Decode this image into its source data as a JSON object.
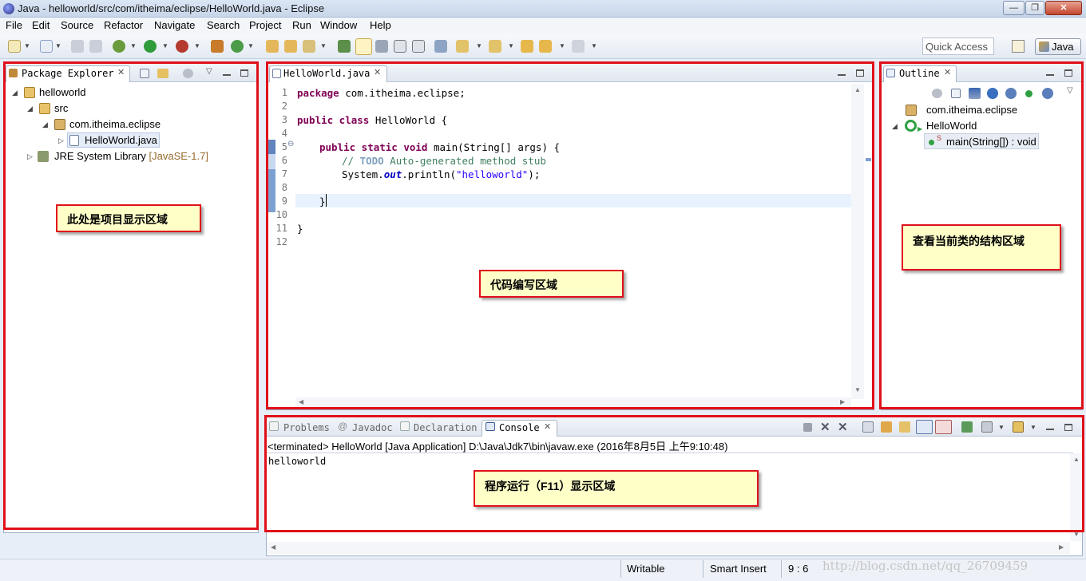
{
  "window": {
    "title": "Java - helloworld/src/com/itheima/eclipse/HelloWorld.java - Eclipse",
    "minimize": "—",
    "maximize": "❐",
    "close": "✕"
  },
  "menu": [
    "File",
    "Edit",
    "Source",
    "Refactor",
    "Navigate",
    "Search",
    "Project",
    "Run",
    "Window",
    "Help"
  ],
  "toolbar": {
    "quick_access_placeholder": "Quick Access",
    "perspective": "Java"
  },
  "package_explorer": {
    "tab_label": "Package Explorer",
    "tree": {
      "project": "helloworld",
      "src": "src",
      "package": "com.itheima.eclipse",
      "file": "HelloWorld.java",
      "library": "JRE System Library",
      "library_version": "[JavaSE-1.7]"
    }
  },
  "editor": {
    "tab_label": "HelloWorld.java",
    "line_numbers": [
      "1",
      "2",
      "3",
      "4",
      "5",
      "6",
      "7",
      "8",
      "9",
      "10",
      "11",
      "12"
    ],
    "code": {
      "l1_kw": "package",
      "l1_rest": " com.itheima.eclipse;",
      "l3_kw": "public class",
      "l3_rest": " HelloWorld {",
      "l5_kw": "public static void",
      "l5_rest": " main(String[] args) {",
      "l6_cm1": "// ",
      "l6_todo": "TODO",
      "l6_cm2": " Auto-generated method stub",
      "l7_a": "System.",
      "l7_field": "out",
      "l7_b": ".println(",
      "l7_str": "\"helloworld\"",
      "l7_c": ");",
      "l9": "}",
      "l11": "}"
    }
  },
  "outline": {
    "tab_label": "Outline",
    "package": "com.itheima.eclipse",
    "class": "HelloWorld",
    "method": "main(String[]) : void",
    "method_modifier": "S"
  },
  "console": {
    "tabs": [
      "Problems",
      "Javadoc",
      "Declaration",
      "Console"
    ],
    "tab_prefix_javadoc": "@",
    "status_line": "<terminated> HelloWorld [Java Application] D:\\Java\\Jdk7\\bin\\javaw.exe (2016年8月5日 上午9:10:48)",
    "output": "helloworld"
  },
  "annotations": {
    "project_area": "此处是项目显示区域",
    "code_area": "代码编写区域",
    "outline_area": "查看当前类的结构区域",
    "console_area": "程序运行（F11）显示区域"
  },
  "statusbar": {
    "writable": "Writable",
    "insert_mode": "Smart Insert",
    "position": "9 : 6"
  },
  "watermark": "http://blog.csdn.net/qq_26709459",
  "colors": {
    "annotation_border": "#e0101a",
    "annotation_fill": "#ffffc8",
    "keyword": "#7f0055",
    "comment": "#3f7f5f",
    "string": "#2a00ff"
  }
}
